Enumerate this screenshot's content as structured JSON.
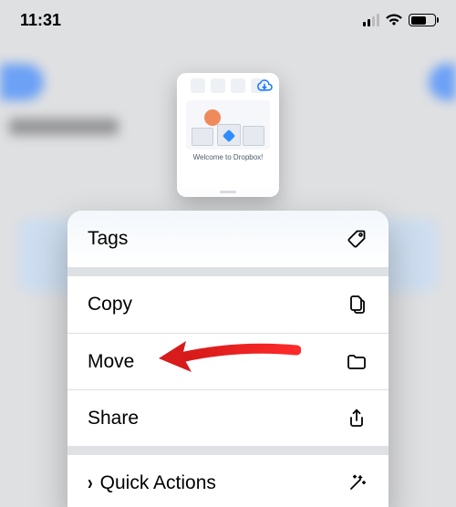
{
  "status": {
    "time": "11:31"
  },
  "preview": {
    "title": "Welcome to Dropbox!"
  },
  "menu": {
    "tags": {
      "label": "Tags"
    },
    "copy": {
      "label": "Copy"
    },
    "move": {
      "label": "Move"
    },
    "share": {
      "label": "Share"
    },
    "quick_actions": {
      "label": "Quick Actions"
    }
  }
}
